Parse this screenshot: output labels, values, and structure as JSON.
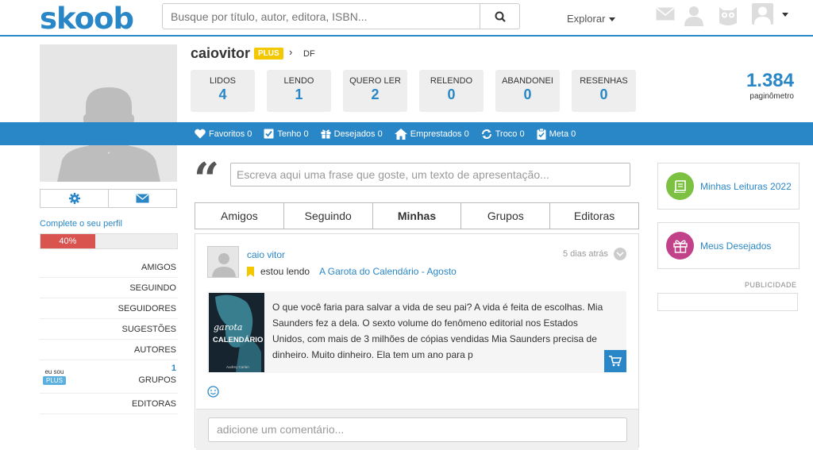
{
  "header": {
    "logo": "skoob",
    "search_placeholder": "Busque por título, autor, editora, ISBN...",
    "explore_label": "Explorar"
  },
  "profile": {
    "username": "caiovitor",
    "plus_badge": "PLUS",
    "location": "DF",
    "complete_link": "Complete o seu perfil",
    "progress_label": "40%",
    "progress_value": 0.4,
    "stats": [
      {
        "label": "LIDOS",
        "value": "4"
      },
      {
        "label": "LENDO",
        "value": "1"
      },
      {
        "label": "QUERO LER",
        "value": "2"
      },
      {
        "label": "RELENDO",
        "value": "0"
      },
      {
        "label": "ABANDONEI",
        "value": "0"
      },
      {
        "label": "RESENHAS",
        "value": "0"
      }
    ],
    "paginometro_value": "1.384",
    "paginometro_label": "paginômetro"
  },
  "bluebar": {
    "favoritos": "Favoritos 0",
    "tenho": "Tenho 0",
    "desejados": "Desejados 0",
    "emprestados": "Emprestados 0",
    "troco": "Troco 0",
    "meta": "Meta 0"
  },
  "sidebar": {
    "amigos": "AMIGOS",
    "seguindo": "SEGUINDO",
    "seguidores": "SEGUIDORES",
    "sugestoes": "SUGESTÕES",
    "autores": "AUTORES",
    "grupos": "GRUPOS",
    "grupos_count": "1",
    "eusou": "eu sou",
    "eusou_plus": "PLUS",
    "editoras": "EDITORAS"
  },
  "about_placeholder": "Escreva aqui uma frase que goste, um texto de apresentação...",
  "tabs": [
    "Amigos",
    "Seguindo",
    "Minhas",
    "Grupos",
    "Editoras"
  ],
  "active_tab": "Minhas",
  "post": {
    "user": "caio vitor",
    "time": "5 dias atrás",
    "action": "estou lendo",
    "book": "A Garota do Calendário - Agosto",
    "excerpt": "O que você faria para salvar a vida de seu pai? A vida é feita de escolhas. Mia Saunders fez a dela. O sexto volume do fenômeno editorial nos Estados Unidos, com mais de 3 milhões de cópias vendidas Mia Saunders precisa de dinheiro. Muito dinheiro. Ela tem um ano para p",
    "cover_title_small": "garota",
    "cover_title": "CALENDÁRIO",
    "cover_author": "Audrey Carlan",
    "comment_placeholder": "adicione um comentário..."
  },
  "right": {
    "leituras": "Minhas Leituras 2022",
    "desejados": "Meus Desejados",
    "publicidade": "PUBLICIDADE"
  },
  "colors": {
    "brand_blue": "#2a87c7",
    "plus_yellow": "#f4c800",
    "progress_red": "#d9534f",
    "leituras_green": "#7cc142",
    "desejados_magenta": "#c2428a"
  }
}
